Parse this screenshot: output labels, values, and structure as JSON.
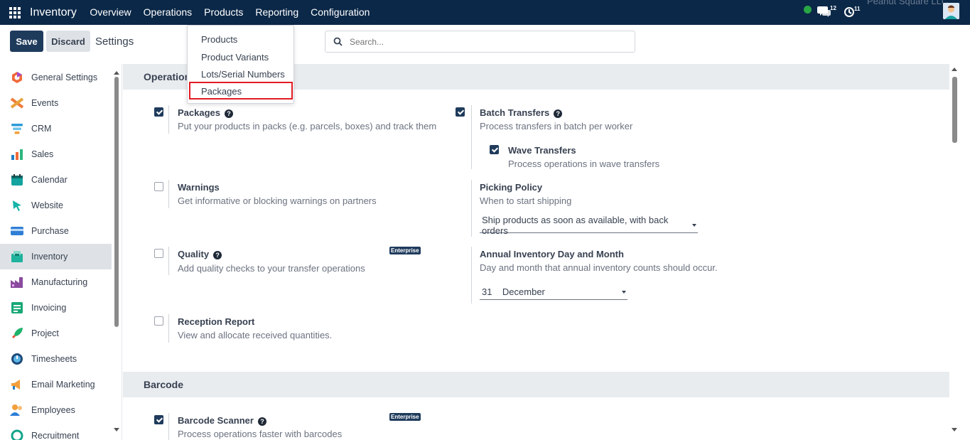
{
  "topbar": {
    "app_name": "Inventory",
    "menu": [
      "Overview",
      "Operations",
      "Products",
      "Reporting",
      "Configuration"
    ],
    "messages_count": "12",
    "activities_count": "11",
    "company": "Peanut Square LLC"
  },
  "control": {
    "save_label": "Save",
    "discard_label": "Discard",
    "title": "Settings",
    "search_placeholder": "Search..."
  },
  "products_menu": {
    "items": [
      "Products",
      "Product Variants",
      "Lots/Serial Numbers",
      "Packages"
    ],
    "highlighted": "Packages"
  },
  "sidebar": {
    "items": [
      {
        "label": "General Settings",
        "icon": "general-settings-icon"
      },
      {
        "label": "Events",
        "icon": "events-icon"
      },
      {
        "label": "CRM",
        "icon": "crm-icon"
      },
      {
        "label": "Sales",
        "icon": "sales-icon"
      },
      {
        "label": "Calendar",
        "icon": "calendar-icon"
      },
      {
        "label": "Website",
        "icon": "website-icon"
      },
      {
        "label": "Purchase",
        "icon": "purchase-icon"
      },
      {
        "label": "Inventory",
        "icon": "inventory-icon"
      },
      {
        "label": "Manufacturing",
        "icon": "manufacturing-icon"
      },
      {
        "label": "Invoicing",
        "icon": "invoicing-icon"
      },
      {
        "label": "Project",
        "icon": "project-icon"
      },
      {
        "label": "Timesheets",
        "icon": "timesheets-icon"
      },
      {
        "label": "Email Marketing",
        "icon": "email-marketing-icon"
      },
      {
        "label": "Employees",
        "icon": "employees-icon"
      },
      {
        "label": "Recruitment",
        "icon": "recruitment-icon"
      }
    ],
    "active": "Inventory"
  },
  "sections": {
    "operations": "Operations",
    "barcode": "Barcode"
  },
  "settings": {
    "packages": {
      "title": "Packages",
      "desc": "Put your products in packs (e.g. parcels, boxes) and track them",
      "checked": true
    },
    "batch": {
      "title": "Batch Transfers",
      "desc": "Process transfers in batch per worker",
      "checked": true
    },
    "wave": {
      "title": "Wave Transfers",
      "desc": "Process operations in wave transfers",
      "checked": true
    },
    "warnings": {
      "title": "Warnings",
      "desc": "Get informative or blocking warnings on partners",
      "checked": false
    },
    "picking": {
      "title": "Picking Policy",
      "desc": "When to start shipping",
      "value": "Ship products as soon as available, with back orders"
    },
    "quality": {
      "title": "Quality",
      "desc": "Add quality checks to your transfer operations",
      "checked": false,
      "badge": "Enterprise"
    },
    "annual": {
      "title": "Annual Inventory Day and Month",
      "desc": "Day and month that annual inventory counts should occur.",
      "day": "31",
      "month": "December"
    },
    "reception": {
      "title": "Reception Report",
      "desc": "View and allocate received quantities.",
      "checked": false
    },
    "barcode_scanner": {
      "title": "Barcode Scanner",
      "desc": "Process operations faster with barcodes",
      "checked": true,
      "badge": "Enterprise"
    }
  },
  "colors": {
    "topbar": "#0b2848",
    "primary": "#1f3b5c",
    "highlight_border": "#e31b23",
    "status_online": "#28a745"
  }
}
